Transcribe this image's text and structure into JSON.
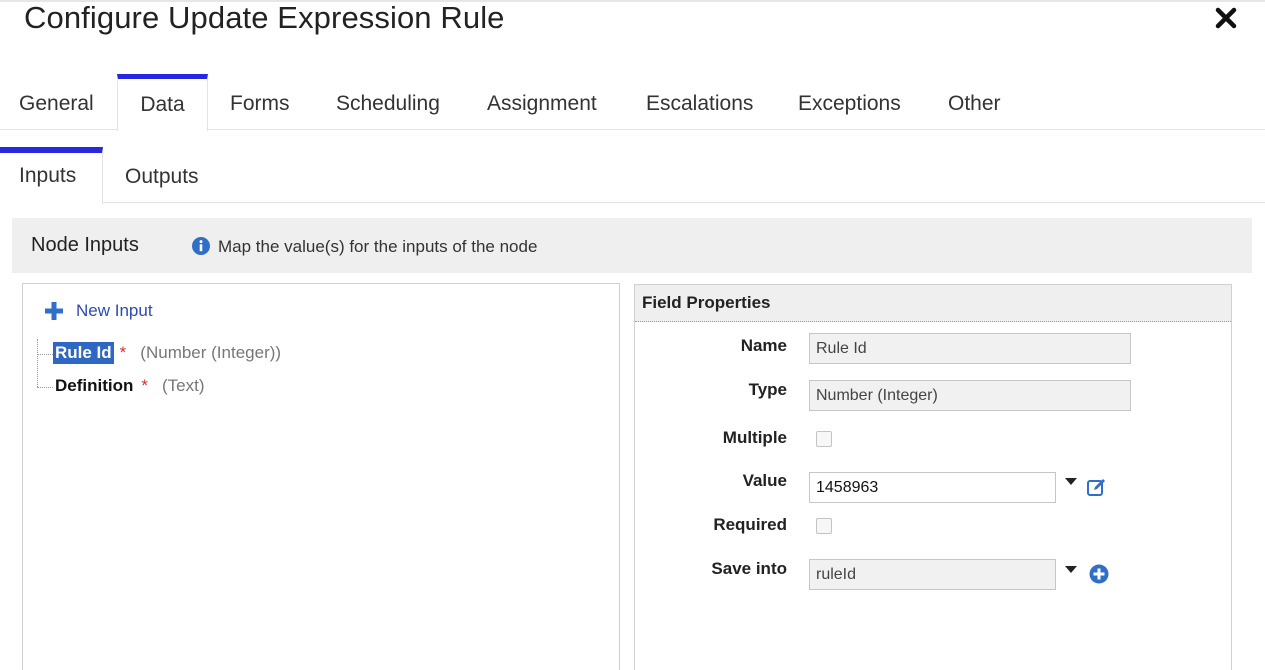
{
  "dialog": {
    "title": "Configure Update Expression Rule",
    "close_icon": "close-icon"
  },
  "tabs": [
    {
      "label": "General",
      "active": false
    },
    {
      "label": "Data",
      "active": true
    },
    {
      "label": "Forms",
      "active": false
    },
    {
      "label": "Scheduling",
      "active": false
    },
    {
      "label": "Assignment",
      "active": false
    },
    {
      "label": "Escalations",
      "active": false
    },
    {
      "label": "Exceptions",
      "active": false
    },
    {
      "label": "Other",
      "active": false
    }
  ],
  "subtabs": [
    {
      "label": "Inputs",
      "active": true
    },
    {
      "label": "Outputs",
      "active": false
    }
  ],
  "node_inputs": {
    "title": "Node Inputs",
    "info_icon": "info-icon",
    "description": "Map the value(s) for the inputs of the node",
    "new_input_label": "New Input",
    "items": [
      {
        "name": "Rule Id",
        "required_mark": "*",
        "type": "(Number (Integer))",
        "selected": true
      },
      {
        "name": "Definition",
        "required_mark": "*",
        "type": "(Text)",
        "selected": false
      }
    ]
  },
  "field_properties": {
    "title": "Field Properties",
    "name_label": "Name",
    "name_value": "Rule Id",
    "type_label": "Type",
    "type_value": "Number (Integer)",
    "multiple_label": "Multiple",
    "multiple_checked": false,
    "value_label": "Value",
    "value_value": "1458963",
    "required_label": "Required",
    "required_checked": false,
    "save_into_label": "Save into",
    "save_into_value": "ruleId"
  },
  "colors": {
    "accent": "#2727e0",
    "link": "#2a4bb5",
    "selected": "#2f68c2",
    "required": "#d9302c",
    "icon_blue": "#2f6fc8"
  }
}
